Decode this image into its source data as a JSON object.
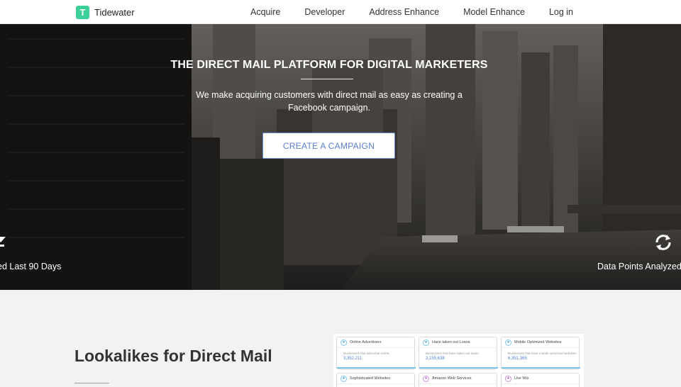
{
  "nav": {
    "brand_initial": "T",
    "brand_name": "Tidewater",
    "links": [
      "Acquire",
      "Developer",
      "Address Enhance",
      "Model Enhance",
      "Log in"
    ]
  },
  "hero": {
    "title": "THE DIRECT MAIL PLATFORM FOR DIGITAL MARKETERS",
    "subtitle": "We make acquiring customers with direct mail as easy as creating a Facebook campaign.",
    "cta_label": "CREATE A CAMPAIGN",
    "stat_left": "ed Last 90 Days",
    "stat_right": "Data Points Analyzed I"
  },
  "section": {
    "title": "Lookalikes for Direct Mail"
  },
  "cards": [
    {
      "title": "Online Advertisers",
      "desc": "Businesses that advertise online.",
      "value": "3,352,211",
      "accent": "#7cc4e8"
    },
    {
      "title": "Have taken out Loans",
      "desc": "Businesses that have taken out loans.",
      "value": "2,155,638",
      "accent": "#7cc4e8"
    },
    {
      "title": "Mobile Optimized Websites",
      "desc": "Businesses that have mobile optimized websites.",
      "value": "6,351,365",
      "accent": "#7cc4e8"
    },
    {
      "title": "Sophisticated Websites",
      "desc": "",
      "value": "",
      "accent": "#7cc4e8"
    },
    {
      "title": "Amazon Web Services",
      "desc": "",
      "value": "",
      "accent": "#c98fd6"
    },
    {
      "title": "Use Wix",
      "desc": "",
      "value": "",
      "accent": "#c98fd6"
    }
  ],
  "colors": {
    "brand": "#3ccf9a",
    "cta_text": "#5a7dd0",
    "card_value": "#4f7fd8"
  }
}
